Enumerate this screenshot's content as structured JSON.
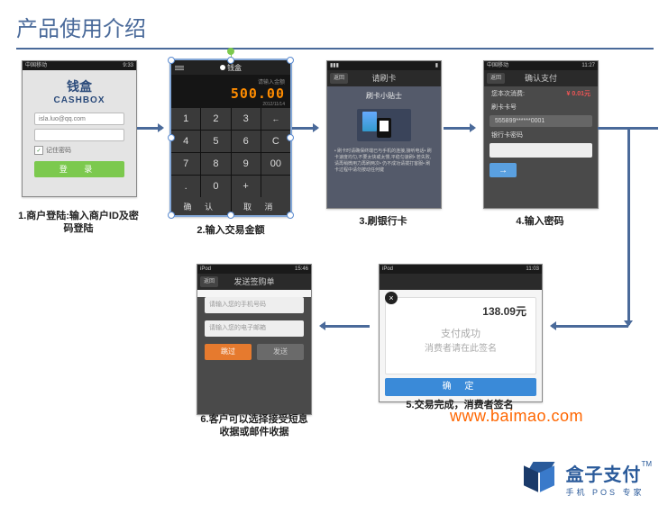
{
  "title": "产品使用介绍",
  "status": {
    "left": "中国移动",
    "t1": "9:33",
    "t2": "11:27",
    "t5": "11:03",
    "t6": "15:46"
  },
  "step1": {
    "logo_zh": "钱盒",
    "logo_en": "CASHBOX",
    "email": "isla.luo@qq.com",
    "pwd_ph": "",
    "remember": "记住密码",
    "login": "登 录",
    "caption": "1.商户登陆:输入商户ID及密码登陆"
  },
  "step2": {
    "brand": "钱盒",
    "disp_label": "请输入金额",
    "value": "500.00",
    "date": "2012/11/14",
    "keys": [
      "1",
      "2",
      "3",
      "←",
      "4",
      "5",
      "6",
      "C",
      "7",
      "8",
      "9",
      "00",
      ".",
      "0",
      "+",
      ""
    ],
    "ok": "确 认",
    "cancel": "取 消",
    "caption": "2.输入交易金额"
  },
  "step3": {
    "head": "请刷卡",
    "back": "返回",
    "title": "刷卡小贴士",
    "tips": "• 刷卡时请确保终端已与手机的连接,接听电话• 刷卡速度均匀,不要太快或太慢,平稳匀速刷• 若失败,请再稍微用力再刷两次• 仍不成功请拨打客服• 刷卡过程中请勿按动任何键",
    "caption": "3.刷银行卡"
  },
  "step4": {
    "head": "确认支付",
    "back": "返回",
    "amt_label": "您本次消费:",
    "amt": "¥ 0.01元",
    "card_label": "刷卡卡号",
    "card": "555899******0001",
    "pwd_label": "银行卡密码",
    "btn": "→",
    "caption": "4.输入密码"
  },
  "step5": {
    "close": "×",
    "amt": "138.09元",
    "succ": "支付成功",
    "sign": "消费者请在此签名",
    "ok": "确 定",
    "caption": "5.交易完成，消费者签名"
  },
  "step6": {
    "head": "发送签购单",
    "back": "返回",
    "ph1": "请输入您的手机号码",
    "ph2": "请输入您的电子邮箱",
    "skip": "跳过",
    "send": "发送",
    "caption": "6.客户可以选择接受短息收据或邮件收据"
  },
  "watermark": "www.baimao.com",
  "brand": {
    "zh": "盒子支付",
    "tag": "手机 POS 专家",
    "tm": "TM"
  }
}
